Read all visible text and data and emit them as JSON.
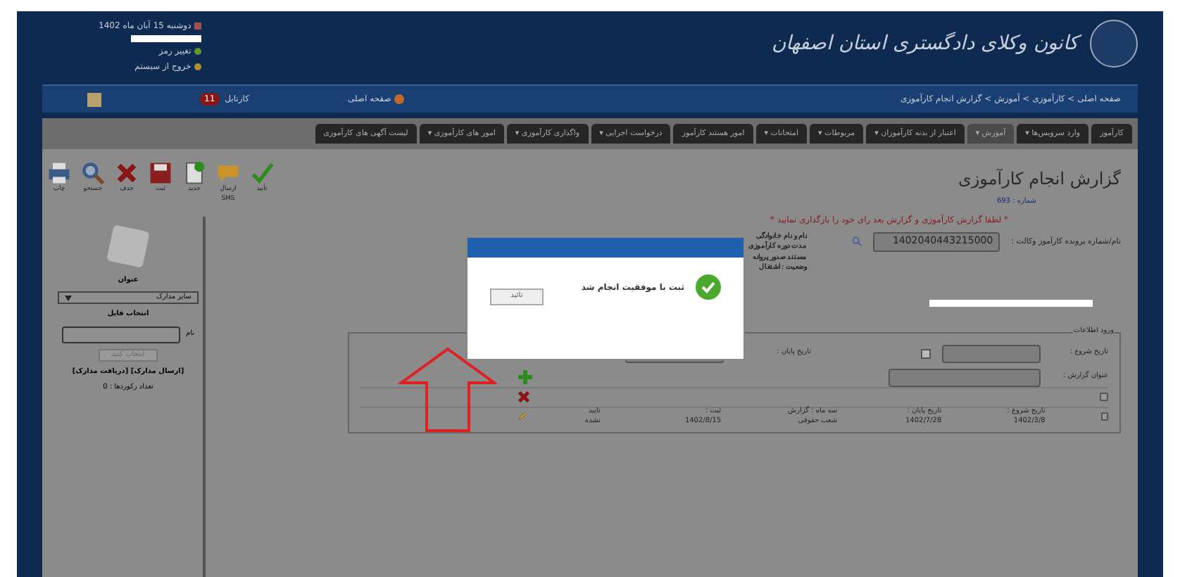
{
  "header": {
    "logo_text": "کانون وکلای دادگستری استان اصفهان",
    "user_lines": [
      "دوشنبه 15 آبان ماه 1402",
      "تغییر رمز",
      "خروج از سیستم"
    ]
  },
  "nav": {
    "home": "صفحه اصلی",
    "inbox": "کارتابل",
    "inbox_badge": "11",
    "breadcrumb": "صفحه اصلی > کارآموزی > آموزش > گزارش انجام کارآموزی"
  },
  "menu_tabs": [
    {
      "label": "کارآموز",
      "selected": false
    },
    {
      "label": "وارد سرویس‌ها ▾",
      "selected": false
    },
    {
      "label": "آموزش ▾",
      "selected": true
    },
    {
      "label": "اعتبار از بدنه کارآموزان ▾",
      "selected": false
    },
    {
      "label": "مربوطات ▾",
      "selected": false
    },
    {
      "label": "امتحانات ▾",
      "selected": false
    },
    {
      "label": "امور هستند کارآموز",
      "selected": false
    },
    {
      "label": "درخواست اجرایی ▾",
      "selected": false
    },
    {
      "label": "واگذاری کارآموزی ▾",
      "selected": false
    },
    {
      "label": "امور های کارآموزی ▾",
      "selected": false
    },
    {
      "label": "لیست آگهی های کارآموزی",
      "selected": false
    }
  ],
  "toolbar": [
    {
      "kind": "confirm",
      "label": "تأیید"
    },
    {
      "kind": "sms",
      "label": "ارسال SMS"
    },
    {
      "kind": "new",
      "label": "جدید"
    },
    {
      "kind": "save",
      "label": "ثبت"
    },
    {
      "kind": "delete",
      "label": "حذف"
    },
    {
      "kind": "search",
      "label": "جستجو"
    },
    {
      "kind": "print",
      "label": "چاپ"
    }
  ],
  "sidebar": {
    "title_label": "عنوان",
    "select_value": "سایر مدارک",
    "file_label": "انتخاب فایل",
    "name_label": "نام",
    "choose_button": "انتخاب کنید",
    "links": "[ارسال مدارک] [دریافت مدارک]",
    "count": "تعداد رکوردها : 0"
  },
  "form": {
    "title": "گزارش انجام کارآموزی",
    "number": "شماره : 693",
    "note": "* لطفا گزارش کارآموزی و گزارش بعد رای خود را بارگذاری نمایید *",
    "file_label": "نام/شماره پرونده کارآموز وکالت :",
    "file_value": "1402040443215000",
    "info_lines": [
      "نام و نام خانوادگی",
      "مدت دوره کارآموزی",
      "مستند صدور پروانه",
      "وضعیت : اشتغال"
    ],
    "legend": "ورود اطلاعات",
    "start_label": "تاریخ شروع :",
    "end_label": "تاریخ پایان :",
    "report_title_label": "عنوان گزارش :"
  },
  "rows": [
    {
      "checked": false,
      "cells": []
    },
    {
      "checked": false,
      "cells": [
        "تاریخ شروع : 1402/3/8",
        "تاریخ پایان : 1402/7/28",
        "سه ماه : گزارش شعب حقوقی",
        "ثبت : 1402/8/15"
      ],
      "status": "تایید نشده"
    }
  ],
  "dialog": {
    "message": "ثبت با موفقیت انجام شد",
    "button": "تائید"
  }
}
